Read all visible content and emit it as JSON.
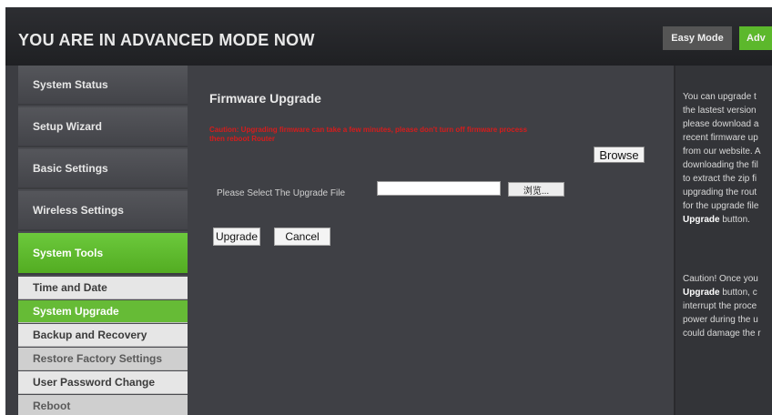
{
  "header": {
    "title": "YOU ARE IN ADVANCED MODE NOW",
    "easy_mode_label": "Easy Mode",
    "advanced_mode_label": "Adv"
  },
  "sidebar": {
    "items": [
      {
        "label": "System Status"
      },
      {
        "label": "Setup Wizard"
      },
      {
        "label": "Basic Settings"
      },
      {
        "label": "Wireless Settings"
      },
      {
        "label": "System Tools"
      }
    ],
    "subitems": [
      {
        "label": "Time and Date"
      },
      {
        "label": "System Upgrade"
      },
      {
        "label": "Backup and Recovery"
      },
      {
        "label": "Restore Factory Settings"
      },
      {
        "label": "User Password Change"
      },
      {
        "label": "Reboot"
      }
    ]
  },
  "main": {
    "title": "Firmware Upgrade",
    "warning_line1": "Caution: Upgrading firmware can take a few minutes, please don't turn off firmware process",
    "warning_line2": "then reboot Router",
    "browse_button": "Browse",
    "select_label": "Please Select The Upgrade File",
    "file_value": "",
    "file_browse_label": "浏览...",
    "upgrade_button": "Upgrade",
    "cancel_button": "Cancel"
  },
  "help": {
    "para1": [
      {
        "text": "You can upgrade t"
      },
      {
        "text": "the lastest version"
      },
      {
        "text": "please download a"
      },
      {
        "text": "recent firmware up"
      },
      {
        "text": "from our website. A"
      },
      {
        "text": "downloading the fil"
      },
      {
        "text": "to extract the zip fi"
      },
      {
        "text": "upgrading the rout"
      },
      {
        "text": "for the upgrade file"
      }
    ],
    "para1_bold_end": "Upgrade",
    "para1_tail": " button.",
    "para2_line1": "Caution! Once you",
    "para2_bold": "Upgrade",
    "para2_line2_tail": " button, c",
    "para2_rest": [
      {
        "text": "interrupt the proce"
      },
      {
        "text": "power during the u"
      },
      {
        "text": "could damage the r"
      }
    ]
  }
}
